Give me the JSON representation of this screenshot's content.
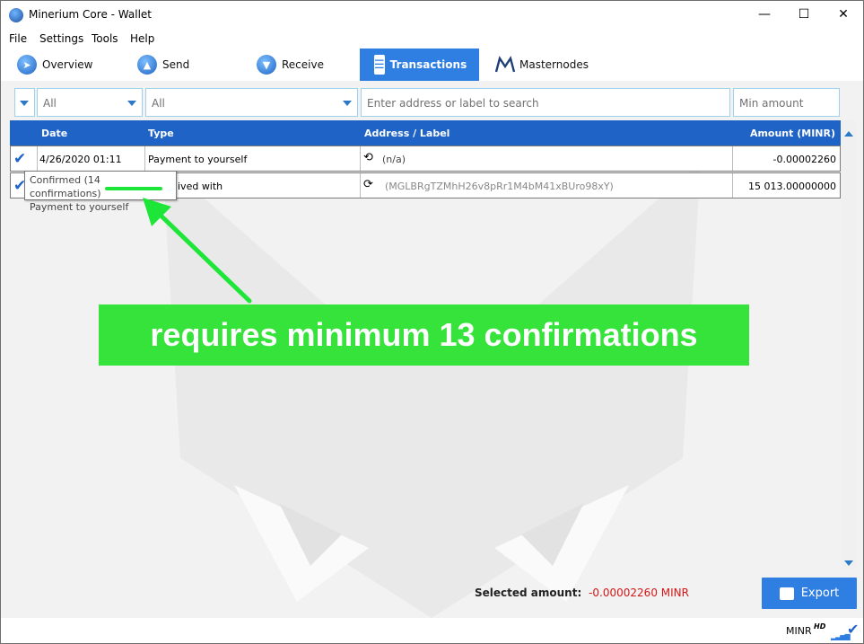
{
  "window": {
    "title": "Minerium Core - Wallet",
    "minimize": "—",
    "maximize": "☐",
    "close": "✕"
  },
  "menu": [
    "File",
    "Settings",
    "Tools",
    "Help"
  ],
  "nav": [
    {
      "label": "Overview",
      "icon": "overview-icon"
    },
    {
      "label": "Send",
      "icon": "send-icon"
    },
    {
      "label": "Receive",
      "icon": "receive-icon"
    },
    {
      "label": "Transactions",
      "icon": "transactions-icon",
      "active": true
    },
    {
      "label": "Masternodes",
      "icon": "masternodes-icon"
    }
  ],
  "filters": {
    "date": "All",
    "type": "All",
    "search_placeholder": "Enter address or label to search",
    "min_amount_placeholder": "Min amount"
  },
  "table": {
    "headers": [
      "Date",
      "Type",
      "Address / Label",
      "Amount (MINR)"
    ],
    "rows": [
      {
        "date": "4/26/2020 01:11",
        "type": "Payment to yourself",
        "address": "(n/a)",
        "amount": "-0.00002260"
      },
      {
        "date": "",
        "type": "ived with",
        "address": "(MGLBRgTZMhH26v8pRr1M4bM41xBUro98xY)",
        "amount": "15 013.00000000"
      }
    ]
  },
  "tooltip": {
    "line1": "Confirmed (14 confirmations)",
    "line2": "Payment to yourself"
  },
  "annotation": {
    "text": "requires minimum 13 confirmations",
    "color": "#35e33a"
  },
  "footer": {
    "selected_label": "Selected amount:",
    "selected_value": "-0.00002260 MINR",
    "export_label": "Export"
  },
  "status": {
    "unit": "MINR",
    "hd": "HD"
  },
  "colors": {
    "accent": "#2f7fe3",
    "header": "#1f63c6",
    "negative": "#d41717"
  }
}
